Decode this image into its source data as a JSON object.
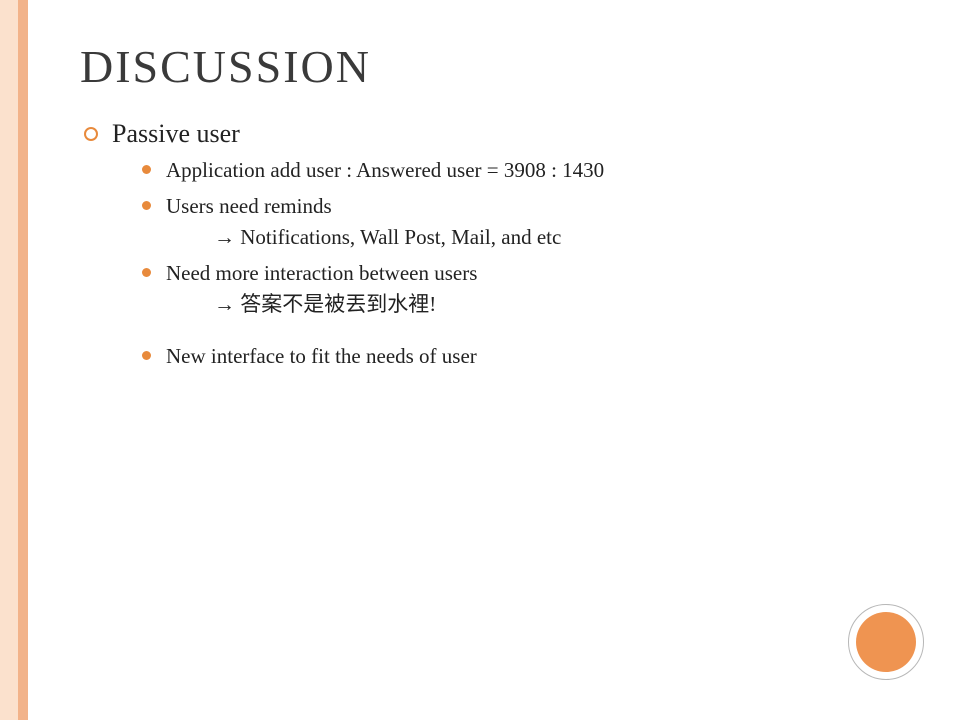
{
  "title": "DISCUSSION",
  "l1": {
    "heading": "Passive user"
  },
  "items": [
    {
      "text": "Application add user : Answered user = 3908 : 1430"
    },
    {
      "text": "Users need reminds",
      "sub": "→ Notifications, Wall Post, Mail, and etc"
    },
    {
      "text": "Need more interaction between users",
      "sub": "→ 答案不是被丟到水裡!"
    },
    {
      "text": "New interface to fit the needs of user"
    }
  ]
}
